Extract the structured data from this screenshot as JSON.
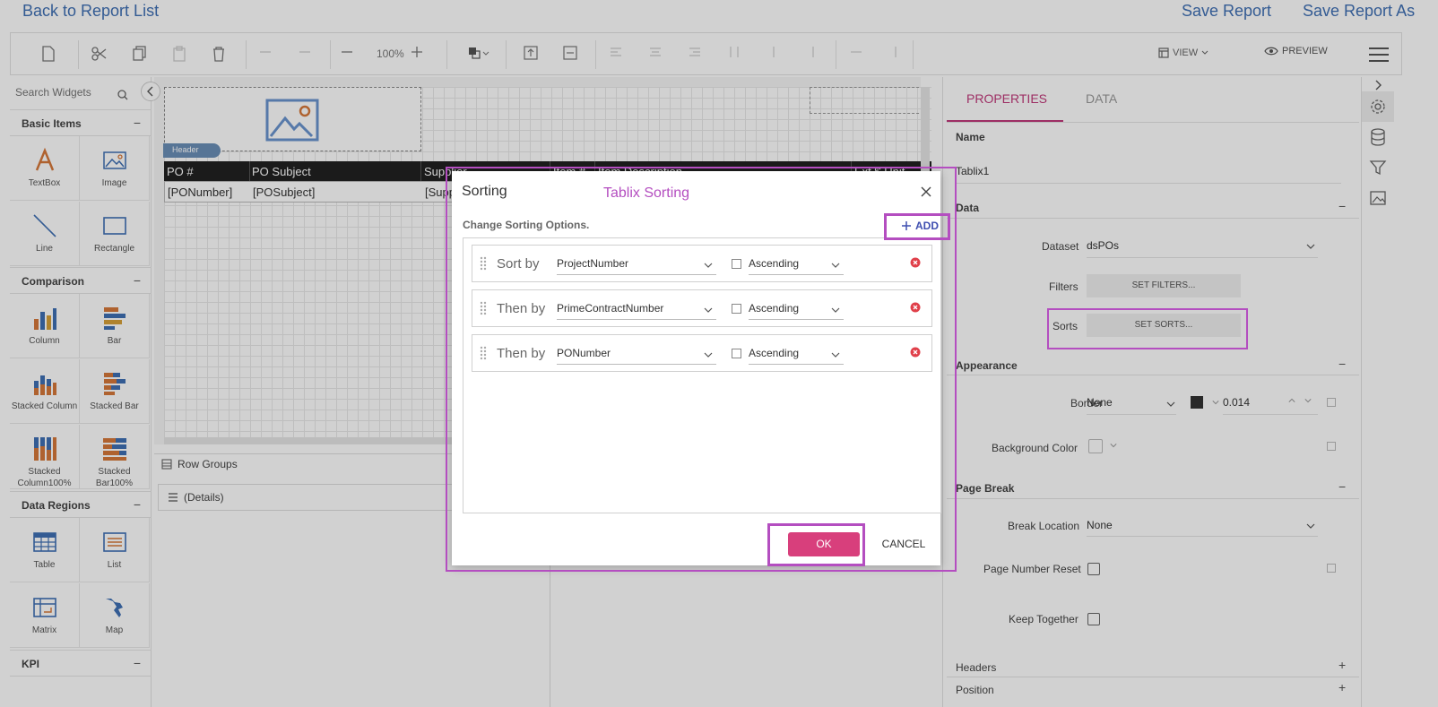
{
  "topbar": {
    "back_label": "Back to Report List",
    "save_label": "Save Report",
    "save_as_label": "Save Report As"
  },
  "toolbar": {
    "zoom": "100%",
    "view_label": "VIEW",
    "preview_label": "PREVIEW",
    "icons": [
      "new-file-icon",
      "cut-icon",
      "copy-icon",
      "paste-icon",
      "delete-icon",
      "undo-icon",
      "redo-icon",
      "zoom-out-icon",
      "zoom-in-icon",
      "layer-icon",
      "align-left-icon",
      "align-center-icon"
    ]
  },
  "widgets": {
    "search_placeholder": "Search Widgets",
    "sections": [
      {
        "title": "Basic Items",
        "items": [
          "TextBox",
          "Image",
          "Line",
          "Rectangle"
        ]
      },
      {
        "title": "Comparison",
        "items": [
          "Column",
          "Bar",
          "Stacked Column",
          "Stacked Bar",
          "Stacked Column100%",
          "Stacked Bar100%"
        ]
      },
      {
        "title": "Data Regions",
        "items": [
          "Table",
          "List",
          "Matrix",
          "Map"
        ]
      },
      {
        "title": "KPI",
        "items": []
      }
    ]
  },
  "canvas": {
    "header_tag": "Header",
    "columns": [
      "PO #",
      "PO Subject",
      "Supplier",
      "Item #",
      "Item Description",
      "Ext $ Unit"
    ],
    "row": [
      "[PONumber]",
      "[POSubject]",
      "[Supp",
      "",
      "",
      ""
    ]
  },
  "groups": {
    "row_groups_label": "Row Groups",
    "details_label": "(Details)"
  },
  "properties": {
    "tab_properties": "PROPERTIES",
    "tab_data": "DATA",
    "name_label": "Name",
    "name_value": "Tablix1",
    "data_section": "Data",
    "dataset_label": "Dataset",
    "dataset_value": "dsPOs",
    "filters_label": "Filters",
    "filters_button": "SET FILTERS...",
    "sorts_label": "Sorts",
    "sorts_button": "SET SORTS...",
    "appearance_section": "Appearance",
    "border_label": "Border",
    "border_value": "None",
    "border_width": "0.014",
    "background_label": "Background Color",
    "page_break_section": "Page Break",
    "break_location_label": "Break Location",
    "break_location_value": "None",
    "page_number_reset_label": "Page Number Reset",
    "keep_together_label": "Keep Together",
    "headers_label": "Headers",
    "position_label": "Position"
  },
  "dialog": {
    "title": "Sorting",
    "annotation_caption": "Tablix Sorting",
    "subtitle": "Change Sorting Options.",
    "add_label": "ADD",
    "rows": [
      {
        "label": "Sort by",
        "field": "ProjectNumber",
        "order": "Ascending"
      },
      {
        "label": "Then by",
        "field": "PrimeContractNumber",
        "order": "Ascending"
      },
      {
        "label": "Then by",
        "field": "PONumber",
        "order": "Ascending"
      }
    ],
    "ok_label": "OK",
    "cancel_label": "CANCEL"
  },
  "colors": {
    "accent": "#c0397a",
    "ok_button": "#d83f7c",
    "annotation": "#b44ec0",
    "link": "#3f6fb4"
  }
}
